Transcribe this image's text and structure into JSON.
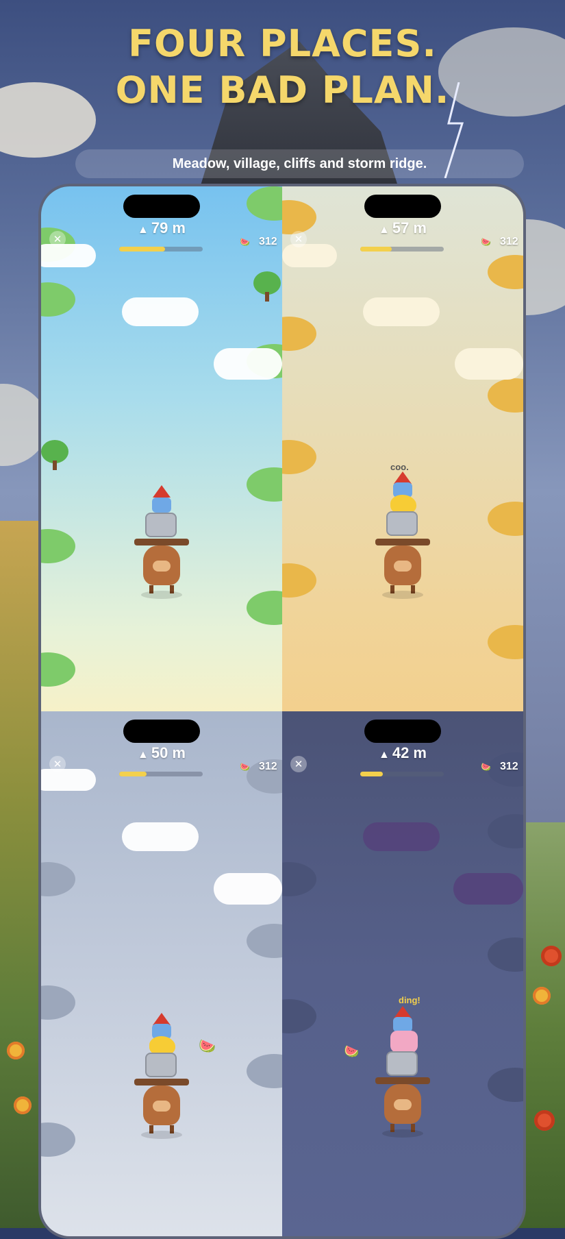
{
  "header": {
    "headline_line1": "FOUR PLACES.",
    "headline_line2": "ONE BAD PLAN.",
    "subtitle": "Meadow, village, cliffs and storm ridge."
  },
  "panels": [
    {
      "name": "meadow",
      "height_label": "79 m",
      "progress": 0.55,
      "score": "312",
      "close_icon": "close-icon",
      "melon_icon": "watermelon-icon"
    },
    {
      "name": "village",
      "height_label": "57 m",
      "progress": 0.38,
      "score": "312",
      "close_icon": "close-icon",
      "melon_icon": "watermelon-icon",
      "speech": "coo."
    },
    {
      "name": "cliffs",
      "height_label": "50 m",
      "progress": 0.33,
      "score": "312",
      "close_icon": "close-icon",
      "melon_icon": "watermelon-icon"
    },
    {
      "name": "storm-ridge",
      "height_label": "42 m",
      "progress": 0.27,
      "score": "312",
      "close_icon": "close-icon",
      "melon_icon": "watermelon-icon",
      "speech": "ding!"
    }
  ],
  "colors": {
    "headline": "#f5d76b",
    "progress_fill": "#f3d04c"
  }
}
